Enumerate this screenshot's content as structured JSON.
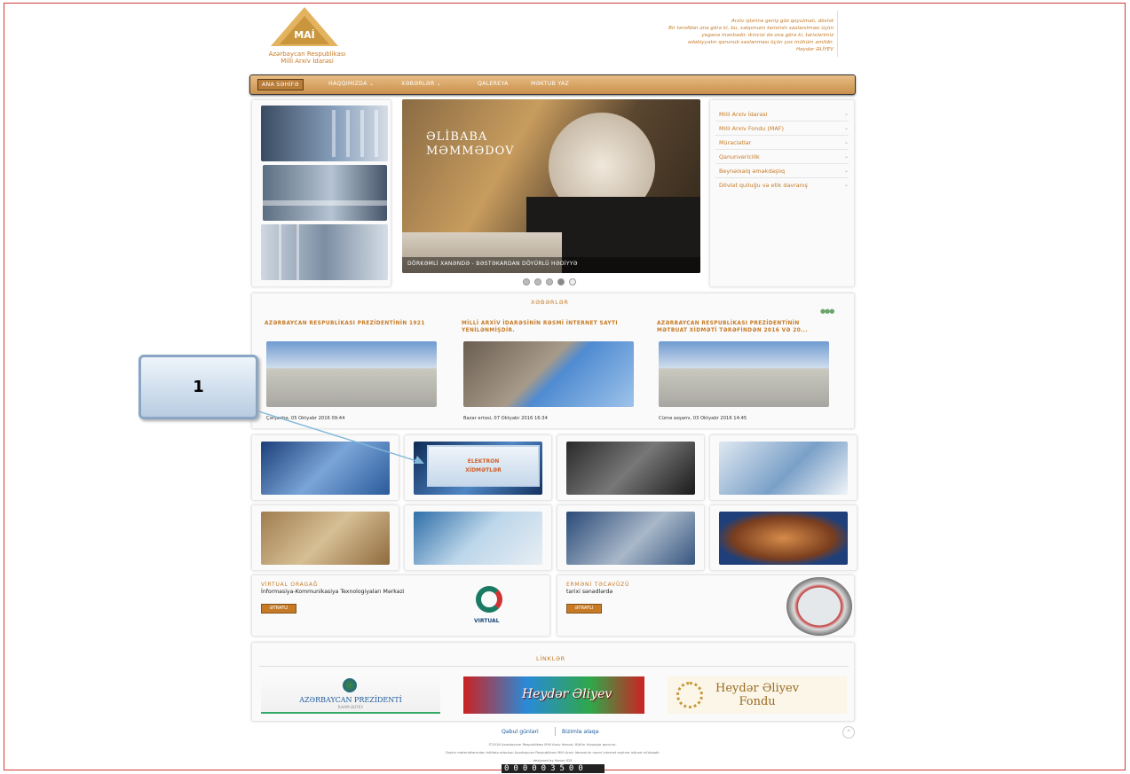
{
  "header": {
    "logo_mark": "MAİ",
    "org_line1": "Azərbaycan Respublikası",
    "org_line2": "Milli Arxiv İdarəsi",
    "quote_line1": "Arxiv işlərinə geniş göz qoyulmalı, dövlət",
    "quote_line2": "Bir tərəfdən ona görə ki, bu, xalqımızın tarixinin saxlanılması üçün",
    "quote_line3": "yeganə mənbədir, ikincisi də ona görə ki, tarixlərimiz",
    "quote_line4": "ədəbiyyatın qorunub saxlanması üçün çox mühüm amildir.",
    "quote_author": "Heydər ƏLİYEV"
  },
  "nav": {
    "items": [
      "ANA SƏHİFƏ",
      "HAQQIMIZDA ⌄",
      "XƏBƏRLƏR ⌄",
      "QALEREYA",
      "MƏKTUB YAZ"
    ]
  },
  "slider": {
    "book_title_line1": "ƏLİBABA",
    "book_title_line2": "MƏMMƏDOV",
    "caption": "DÖRKƏMLİ XANƏNDƏ - BƏSTƏKARDAN DÖYÜRLÜ HƏDİYYƏ"
  },
  "sidebar": {
    "items": [
      "Milli Arxiv İdarəsi",
      "Milli Arxiv Fondu (MAF)",
      "Müraciətlər",
      "Qanunvericilik",
      "Beynəlxalq əməkdaşlıq",
      "Dövlət qulluğu və etik davranış"
    ]
  },
  "news": {
    "title": "XƏBƏRLƏR",
    "items": [
      {
        "title": "AZƏRBAYCAN RESPUBLİKASI PREZİDENTİNİN 1921",
        "date": "Çərşənbə, 05 Oktyabr 2016 09:44"
      },
      {
        "title": "MİLLİ ARXİV İDARƏSİNİN RƏSMİ İNTERNET SAYTI YENİLƏNMİŞDİR.",
        "date": "Bazar ertəsi, 07 Oktyabr 2016 16:34"
      },
      {
        "title": "AZƏRBAYCAN RESPUBLİKASI PREZİDENTİNİN MƏTBUAT XİDMƏTİ TƏRƏFİNDƏN 2016 VƏ 20...",
        "date": "Cümə axşamı, 03 Oktyabr 2016 14:45"
      }
    ]
  },
  "promo": {
    "left_title": "VİRTUAL ORAGAĞ",
    "left_sub": "İnformasiya-Kommunikasiya Texnologiyaları Mərkəzi",
    "left_btn": "ƏTRAFLI",
    "left_logo": "VIRTUAL",
    "right_title": "ERMƏNİ TƏCAVÜZÜ",
    "right_sub": "tarixi sənədlərdə",
    "right_btn": "ƏTRAFLI"
  },
  "links": {
    "title": "LİNKLƏR",
    "prezident_line1": "AZƏRBAYCAN PREZİDENTİ",
    "prezident_line2": "İLHAM ƏLİYEV",
    "heydar": "Heydər Əliyev",
    "fond_line1": "Heydər Əliyev",
    "fond_line2": "Fondu"
  },
  "footer": {
    "link1": "Qəbul günləri",
    "link2": "Bizimlə əlaqə",
    "line1": "©2016 Azərbaycan Respublikası Milli Arxiv İdarəsi. Bütün hüquqlar qorunur.",
    "line2": "Saytın materiallarından istifadə edərkən Azərbaycan Respublikası Milli Arxiv İdarəsinin rəsmi internet saytına istinad mütləqdir",
    "line3": "designed by Xenon IDS",
    "counter": "000003500"
  },
  "annotations": {
    "callout_number": "1",
    "elx_line1": "ELEKTRON",
    "elx_line2": "XİDMƏTLƏR"
  },
  "colors": {
    "accent": "#c67a25",
    "nav": "#d9a461",
    "frame": "#cf3a3a"
  }
}
